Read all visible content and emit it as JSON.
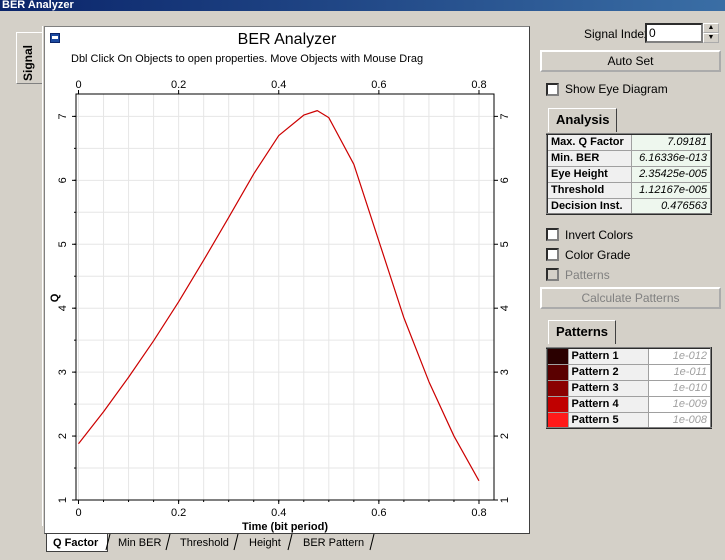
{
  "window": {
    "title": "BER Analyzer"
  },
  "side_tab": {
    "label": "Signal"
  },
  "plot": {
    "title": "BER Analyzer",
    "subtitle": "Dbl Click On Objects to open properties.  Move Objects with Mouse Drag"
  },
  "chart_data": {
    "type": "line",
    "title": "BER Analyzer",
    "xlabel": "Time (bit period)",
    "ylabel": "Q",
    "xlim": [
      -0.005,
      0.83
    ],
    "ylim": [
      1.0,
      7.35
    ],
    "x_ticks": [
      "0",
      "0.2",
      "0.4",
      "0.6",
      "0.8"
    ],
    "y_ticks": [
      "1",
      "2",
      "3",
      "4",
      "5",
      "6",
      "7"
    ],
    "grid": true,
    "color": "#cc0000",
    "series": [
      {
        "x": [
          0.0,
          0.05,
          0.1,
          0.15,
          0.2,
          0.25,
          0.3,
          0.35,
          0.4,
          0.45,
          0.477,
          0.5,
          0.55,
          0.6,
          0.65,
          0.7,
          0.75,
          0.8
        ],
        "y": [
          1.88,
          2.38,
          2.92,
          3.49,
          4.1,
          4.75,
          5.42,
          6.1,
          6.7,
          7.02,
          7.09,
          6.98,
          6.25,
          5.05,
          3.85,
          2.85,
          2.0,
          1.3
        ]
      }
    ]
  },
  "bottom_tabs": [
    "Q Factor",
    "Min BER",
    "Threshold",
    "Height",
    "BER Pattern"
  ],
  "signal_index": {
    "label": "Signal Index:",
    "value": "0"
  },
  "auto_set": {
    "label": "Auto Set"
  },
  "show_eye": {
    "label": "Show Eye Diagram"
  },
  "analysis": {
    "tab": "Analysis",
    "rows": [
      {
        "key": "Max. Q Factor",
        "value": "7.09181"
      },
      {
        "key": "Min. BER",
        "value": "6.16336e-013"
      },
      {
        "key": "Eye Height",
        "value": "2.35425e-005"
      },
      {
        "key": "Threshold",
        "value": "1.12167e-005"
      },
      {
        "key": "Decision Inst.",
        "value": "0.476563"
      }
    ]
  },
  "invert_colors": {
    "label": "Invert Colors"
  },
  "color_grade": {
    "label": "Color Grade"
  },
  "patterns_check": {
    "label": "Patterns"
  },
  "calc_patterns": {
    "label": "Calculate Patterns"
  },
  "patterns": {
    "tab": "Patterns",
    "rows": [
      {
        "name": "Pattern 1",
        "value": "1e-012",
        "color": "#2a0000"
      },
      {
        "name": "Pattern 2",
        "value": "1e-011",
        "color": "#5a0000"
      },
      {
        "name": "Pattern 3",
        "value": "1e-010",
        "color": "#8a0000"
      },
      {
        "name": "Pattern 4",
        "value": "1e-009",
        "color": "#c00000"
      },
      {
        "name": "Pattern 5",
        "value": "1e-008",
        "color": "#ff1a1a"
      }
    ]
  }
}
